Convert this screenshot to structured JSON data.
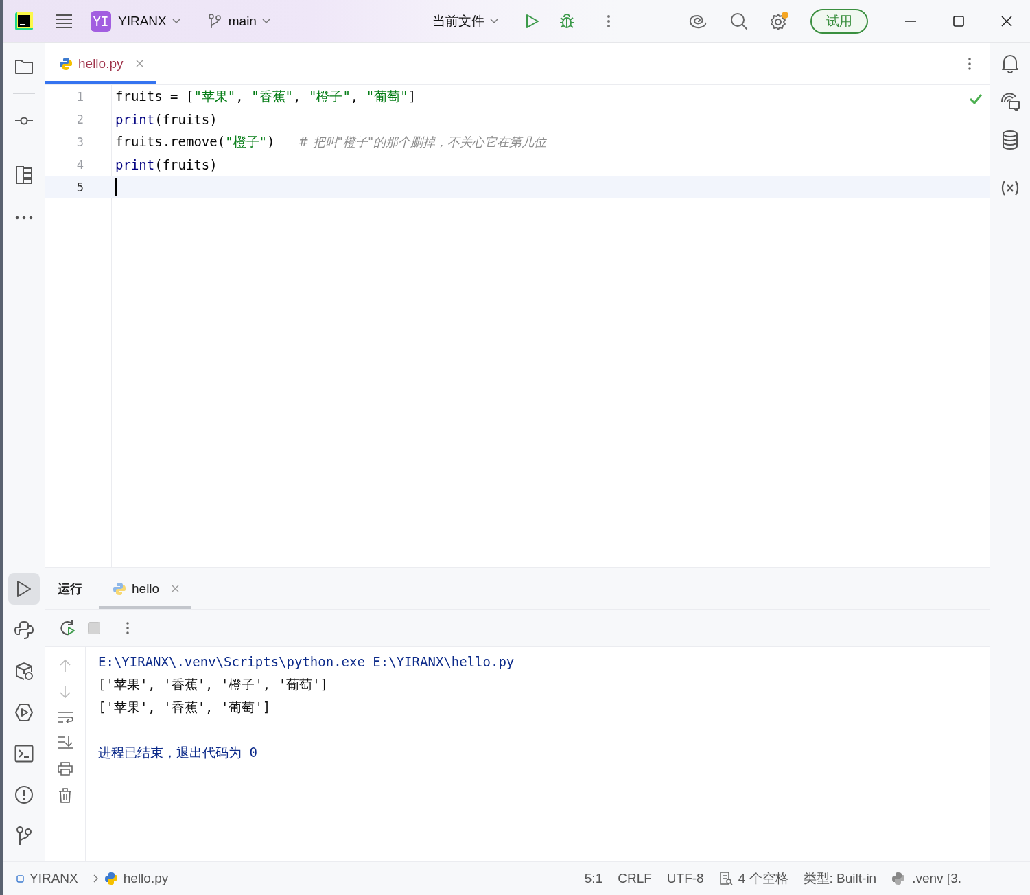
{
  "title_bar": {
    "project_badge": "YI",
    "project": "YIRANX",
    "branch": "main",
    "run_config": "当前文件",
    "trial_button": "试用"
  },
  "left_tools_top": [
    {
      "kind": "folder",
      "selected": false
    },
    {
      "kind": "commit",
      "selected": false
    },
    {
      "kind": "structure",
      "selected": false
    },
    {
      "kind": "more",
      "selected": false
    }
  ],
  "left_tools_bottom": [
    {
      "kind": "run",
      "selected": true
    },
    {
      "kind": "python",
      "selected": false
    },
    {
      "kind": "packages",
      "selected": false
    },
    {
      "kind": "services",
      "selected": false
    },
    {
      "kind": "terminal",
      "selected": false
    },
    {
      "kind": "problems",
      "selected": false
    },
    {
      "kind": "git",
      "selected": false
    }
  ],
  "editor_tabs": [
    {
      "label": "hello.py",
      "selected": true
    }
  ],
  "code_lines": [
    {
      "number": "1",
      "current": false,
      "tokens": [
        {
          "kind": "plain",
          "text": "fruits = ["
        },
        {
          "kind": "string",
          "text": "\"苹果\""
        },
        {
          "kind": "plain",
          "text": ", "
        },
        {
          "kind": "string",
          "text": "\"香蕉\""
        },
        {
          "kind": "plain",
          "text": ", "
        },
        {
          "kind": "string",
          "text": "\"橙子\""
        },
        {
          "kind": "plain",
          "text": ", "
        },
        {
          "kind": "string",
          "text": "\"葡萄\""
        },
        {
          "kind": "plain",
          "text": "]"
        }
      ]
    },
    {
      "number": "2",
      "current": false,
      "tokens": [
        {
          "kind": "builtin",
          "text": "print"
        },
        {
          "kind": "plain",
          "text": "(fruits)"
        }
      ]
    },
    {
      "number": "3",
      "current": false,
      "tokens": [
        {
          "kind": "plain",
          "text": "fruits.remove("
        },
        {
          "kind": "string",
          "text": "\"橙子\""
        },
        {
          "kind": "plain",
          "text": ")   "
        },
        {
          "kind": "comment",
          "text": "# 把叫\"橙子\"的那个删掉，不关心它在第几位"
        }
      ]
    },
    {
      "number": "4",
      "current": false,
      "tokens": [
        {
          "kind": "builtin",
          "text": "print"
        },
        {
          "kind": "plain",
          "text": "(fruits)"
        }
      ]
    },
    {
      "number": "5",
      "current": true
    }
  ],
  "run_panel": {
    "title": "运行",
    "tabs": [
      {
        "label": "hello",
        "selected": true
      }
    ],
    "output": [
      {
        "kind": "command",
        "text": "E:\\YIRANX\\.venv\\Scripts\\python.exe E:\\YIRANX\\hello.py"
      },
      {
        "kind": "stdout",
        "text": "['苹果', '香蕉', '橙子', '葡萄']"
      },
      {
        "kind": "stdout",
        "text": "['苹果', '香蕉', '葡萄']"
      },
      {
        "kind": "status",
        "text": "进程已结束，退出代码为 0"
      }
    ]
  },
  "status_bar": {
    "breadcrumbs": [
      "YIRANX",
      "hello.py"
    ],
    "items": [
      "5:1",
      "CRLF",
      "UTF-8",
      "4 个空格",
      "类型: Built-in",
      ".venv [3."
    ]
  }
}
